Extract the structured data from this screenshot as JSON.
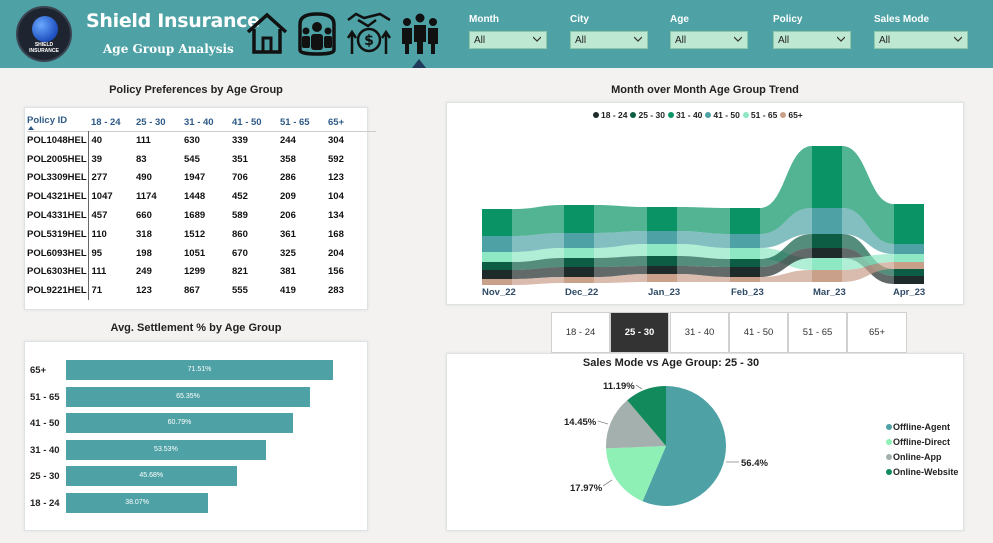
{
  "header": {
    "logo_text_1": "SHIELD",
    "logo_text_2": "INSURANCE",
    "title": "Shield Insurance",
    "subtitle": "Age Group Analysis",
    "nav": [
      "home-icon",
      "customers-icon",
      "money-hands-icon",
      "age-group-icon"
    ]
  },
  "filters": [
    {
      "label": "Month",
      "value": "All"
    },
    {
      "label": "City",
      "value": "All"
    },
    {
      "label": "Age",
      "value": "All"
    },
    {
      "label": "Policy",
      "value": "All"
    },
    {
      "label": "Sales Mode",
      "value": "All"
    }
  ],
  "policy_table": {
    "title": "Policy Preferences by Age Group",
    "columns": [
      "Policy ID",
      "18 - 24",
      "25 - 30",
      "31 - 40",
      "41 - 50",
      "51 - 65",
      "65+"
    ],
    "rows": [
      [
        "POL1048HEL",
        "40",
        "111",
        "630",
        "339",
        "244",
        "304"
      ],
      [
        "POL2005HEL",
        "39",
        "83",
        "545",
        "351",
        "358",
        "592"
      ],
      [
        "POL3309HEL",
        "277",
        "490",
        "1947",
        "706",
        "286",
        "123"
      ],
      [
        "POL4321HEL",
        "1047",
        "1174",
        "1448",
        "452",
        "209",
        "104"
      ],
      [
        "POL4331HEL",
        "457",
        "660",
        "1689",
        "589",
        "206",
        "134"
      ],
      [
        "POL5319HEL",
        "110",
        "318",
        "1512",
        "860",
        "361",
        "168"
      ],
      [
        "POL6093HEL",
        "95",
        "198",
        "1051",
        "670",
        "325",
        "204"
      ],
      [
        "POL6303HEL",
        "111",
        "249",
        "1299",
        "821",
        "381",
        "156"
      ],
      [
        "POL9221HEL",
        "71",
        "123",
        "867",
        "555",
        "419",
        "283"
      ]
    ]
  },
  "settlement": {
    "title": "Avg. Settlement % by Age Group",
    "categories": [
      "65+",
      "51 - 65",
      "41 - 50",
      "31 - 40",
      "25 - 30",
      "18 - 24"
    ],
    "values": [
      71.51,
      65.35,
      60.79,
      53.53,
      45.68,
      38.07
    ],
    "value_labels": [
      "71.51%",
      "65.35%",
      "60.79%",
      "53.53%",
      "45.68%",
      "38.07%"
    ]
  },
  "trend": {
    "title": "Month over Month Age Group Trend",
    "legend": [
      {
        "label": "18 - 24",
        "color": "#1f2a2a"
      },
      {
        "label": "25 - 30",
        "color": "#0d5c44"
      },
      {
        "label": "31 - 40",
        "color": "#0a9466"
      },
      {
        "label": "41 - 50",
        "color": "#4ea2a6"
      },
      {
        "label": "51 - 65",
        "color": "#8ee8c4"
      },
      {
        "label": "65+",
        "color": "#c9a08a"
      }
    ],
    "months": [
      "Nov_22",
      "Dec_22",
      "Jan_23",
      "Feb_23",
      "Mar_23",
      "Apr_23"
    ]
  },
  "slicer": {
    "options": [
      "18 - 24",
      "25 - 30",
      "31 - 40",
      "41 - 50",
      "51 - 65",
      "65+"
    ],
    "selected": "25 - 30"
  },
  "sales_mode": {
    "title": "Sales Mode vs Age Group: 25 - 30",
    "chart_data": {
      "type": "pie",
      "labels": [
        "Offline-Agent",
        "Offline-Direct",
        "Online-App",
        "Online-Website"
      ],
      "values": [
        56.4,
        17.97,
        14.45,
        11.19
      ],
      "value_labels": [
        "56.4%",
        "17.97%",
        "14.45%",
        "11.19%"
      ],
      "colors": [
        "#4ea2a6",
        "#8ef0b4",
        "#a4b0ad",
        "#138a5c"
      ],
      "legend_position": "right"
    }
  }
}
